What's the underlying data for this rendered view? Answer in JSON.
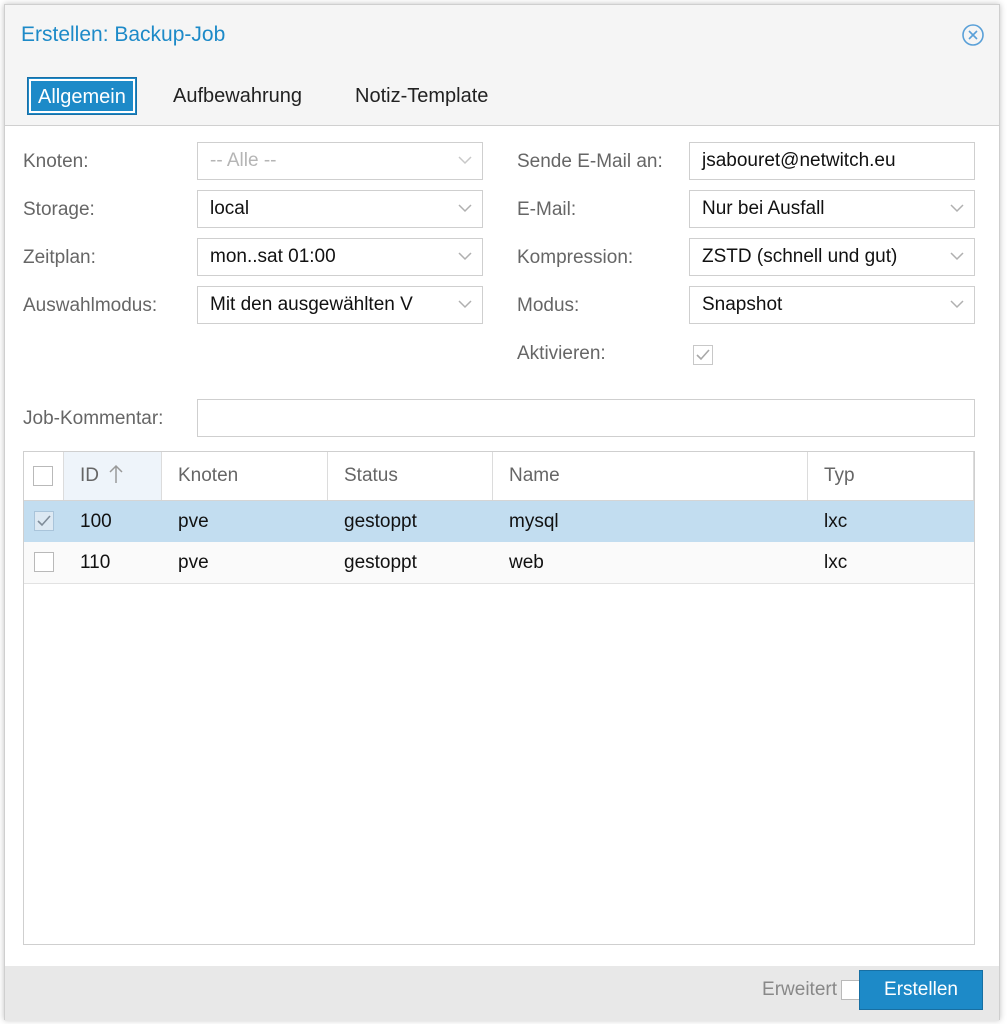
{
  "dialog": {
    "title": "Erstellen: Backup-Job",
    "close_icon": "close-circle-icon"
  },
  "tabs": [
    {
      "label": "Allgemein",
      "active": true
    },
    {
      "label": "Aufbewahrung",
      "active": false
    },
    {
      "label": "Notiz-Template",
      "active": false
    }
  ],
  "form": {
    "knoten": {
      "label": "Knoten:",
      "value": "-- Alle --"
    },
    "storage": {
      "label": "Storage:",
      "value": "local"
    },
    "zeitplan": {
      "label": "Zeitplan:",
      "value": "mon..sat 01:00"
    },
    "auswahlmodus": {
      "label": "Auswahlmodus:",
      "value": "Mit den ausgewählten V"
    },
    "sende_email": {
      "label": "Sende E-Mail an:",
      "value": "jsabouret@netwitch.eu"
    },
    "email": {
      "label": "E-Mail:",
      "value": "Nur bei Ausfall"
    },
    "kompression": {
      "label": "Kompression:",
      "value": "ZSTD (schnell und gut)"
    },
    "modus": {
      "label": "Modus:",
      "value": "Snapshot"
    },
    "aktivieren": {
      "label": "Aktivieren:",
      "checked": true
    },
    "job_kommentar": {
      "label": "Job-Kommentar:",
      "value": ""
    }
  },
  "grid": {
    "columns": [
      "ID",
      "Knoten",
      "Status",
      "Name",
      "Typ"
    ],
    "sort_icon": "arrow-up-icon",
    "rows": [
      {
        "id": "100",
        "knoten": "pve",
        "status": "gestoppt",
        "name": "mysql",
        "typ": "lxc",
        "selected": true
      },
      {
        "id": "110",
        "knoten": "pve",
        "status": "gestoppt",
        "name": "web",
        "typ": "lxc",
        "selected": false
      }
    ]
  },
  "footer": {
    "erweitert_label": "Erweitert",
    "submit_label": "Erstellen"
  },
  "colors": {
    "accent": "#1d8ac8",
    "selected_row": "#c2ddf0"
  }
}
